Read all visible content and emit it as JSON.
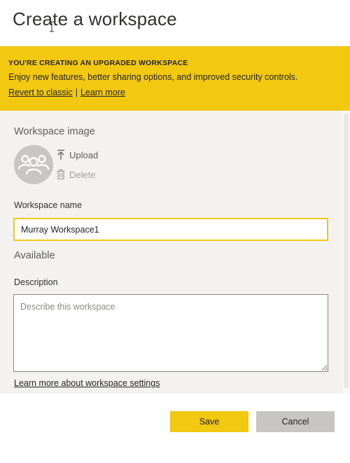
{
  "dialog": {
    "title": "Create a workspace"
  },
  "banner": {
    "heading": "YOU'RE CREATING AN UPGRADED WORKSPACE",
    "text": "Enjoy new features, better sharing options, and improved security controls.",
    "revert_link": "Revert to classic",
    "separator": "|",
    "learn_more_link": "Learn more"
  },
  "workspace_image": {
    "label": "Workspace image",
    "avatar_icon": "people-group-icon",
    "upload_label": "Upload",
    "upload_icon": "upload-arrow-icon",
    "delete_label": "Delete",
    "delete_icon": "trash-icon"
  },
  "workspace_name": {
    "label": "Workspace name",
    "value": "Murray Workspace1",
    "availability": "Available"
  },
  "description": {
    "label": "Description",
    "value": "",
    "placeholder": "Describe this workspace"
  },
  "settings_link": "Learn more about workspace settings",
  "buttons": {
    "save_label": "Save",
    "cancel_label": "Cancel"
  },
  "colors": {
    "accent": "#f2c811",
    "panel_bg": "#f3f2f1",
    "secondary_button": "#c8c6c4"
  }
}
